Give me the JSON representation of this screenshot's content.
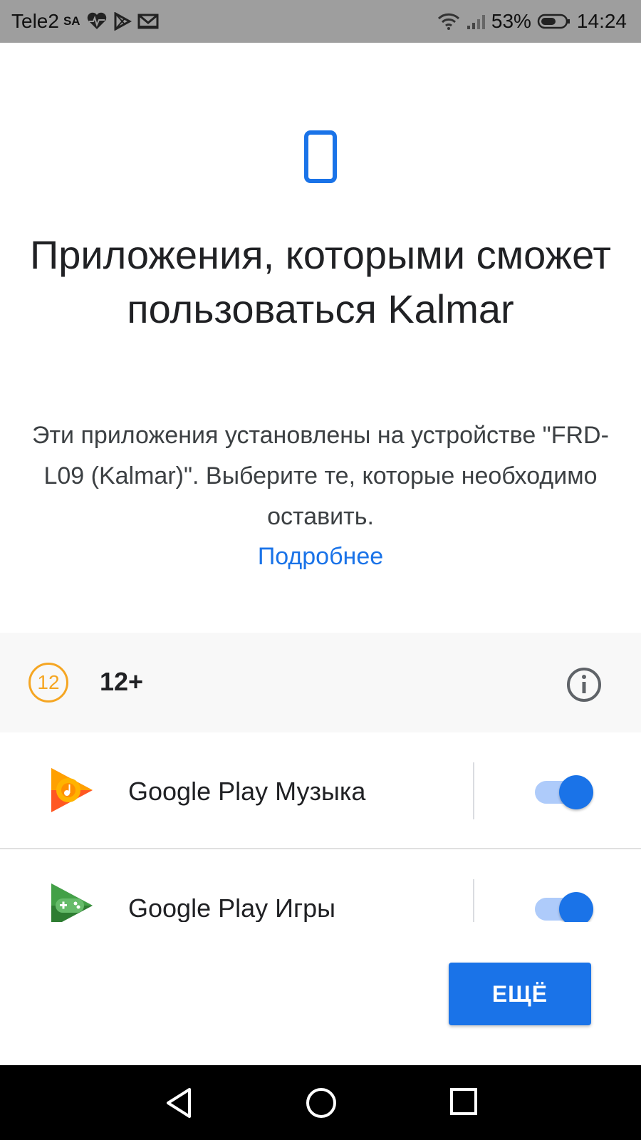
{
  "status_bar": {
    "carrier": "Tele2",
    "carrier_badge": "SA",
    "icons_left": [
      "heart-rate-icon",
      "play-store-icon",
      "gmail-icon"
    ],
    "battery_percent": "53%",
    "time": "14:24",
    "icons_right": [
      "wifi-icon",
      "signal-icon",
      "battery-icon"
    ]
  },
  "main": {
    "icon": "phone-icon",
    "title": "Приложения, которыми сможет пользоваться Kalmar",
    "description": "Эти приложения установлены на устройстве \"FRD-L09 (Kalmar)\". Выберите те, которые необходимо оставить.",
    "more_link": "Подробнее"
  },
  "rating": {
    "badge": "12",
    "label": "12+",
    "badge_color": "#f5a623",
    "info_icon": "info-icon"
  },
  "apps": [
    {
      "name": "Google Play Музыка",
      "icon": "google-play-music-icon",
      "enabled": true
    },
    {
      "name": "Google Play Игры",
      "icon": "google-play-games-icon",
      "enabled": true
    }
  ],
  "actions": {
    "more_button": "ЕЩЁ"
  },
  "colors": {
    "accent": "#1a73e8",
    "toggle_track": "#aecbfa"
  },
  "nav_bar": {
    "buttons": [
      "back-icon",
      "home-icon",
      "recents-icon"
    ]
  }
}
